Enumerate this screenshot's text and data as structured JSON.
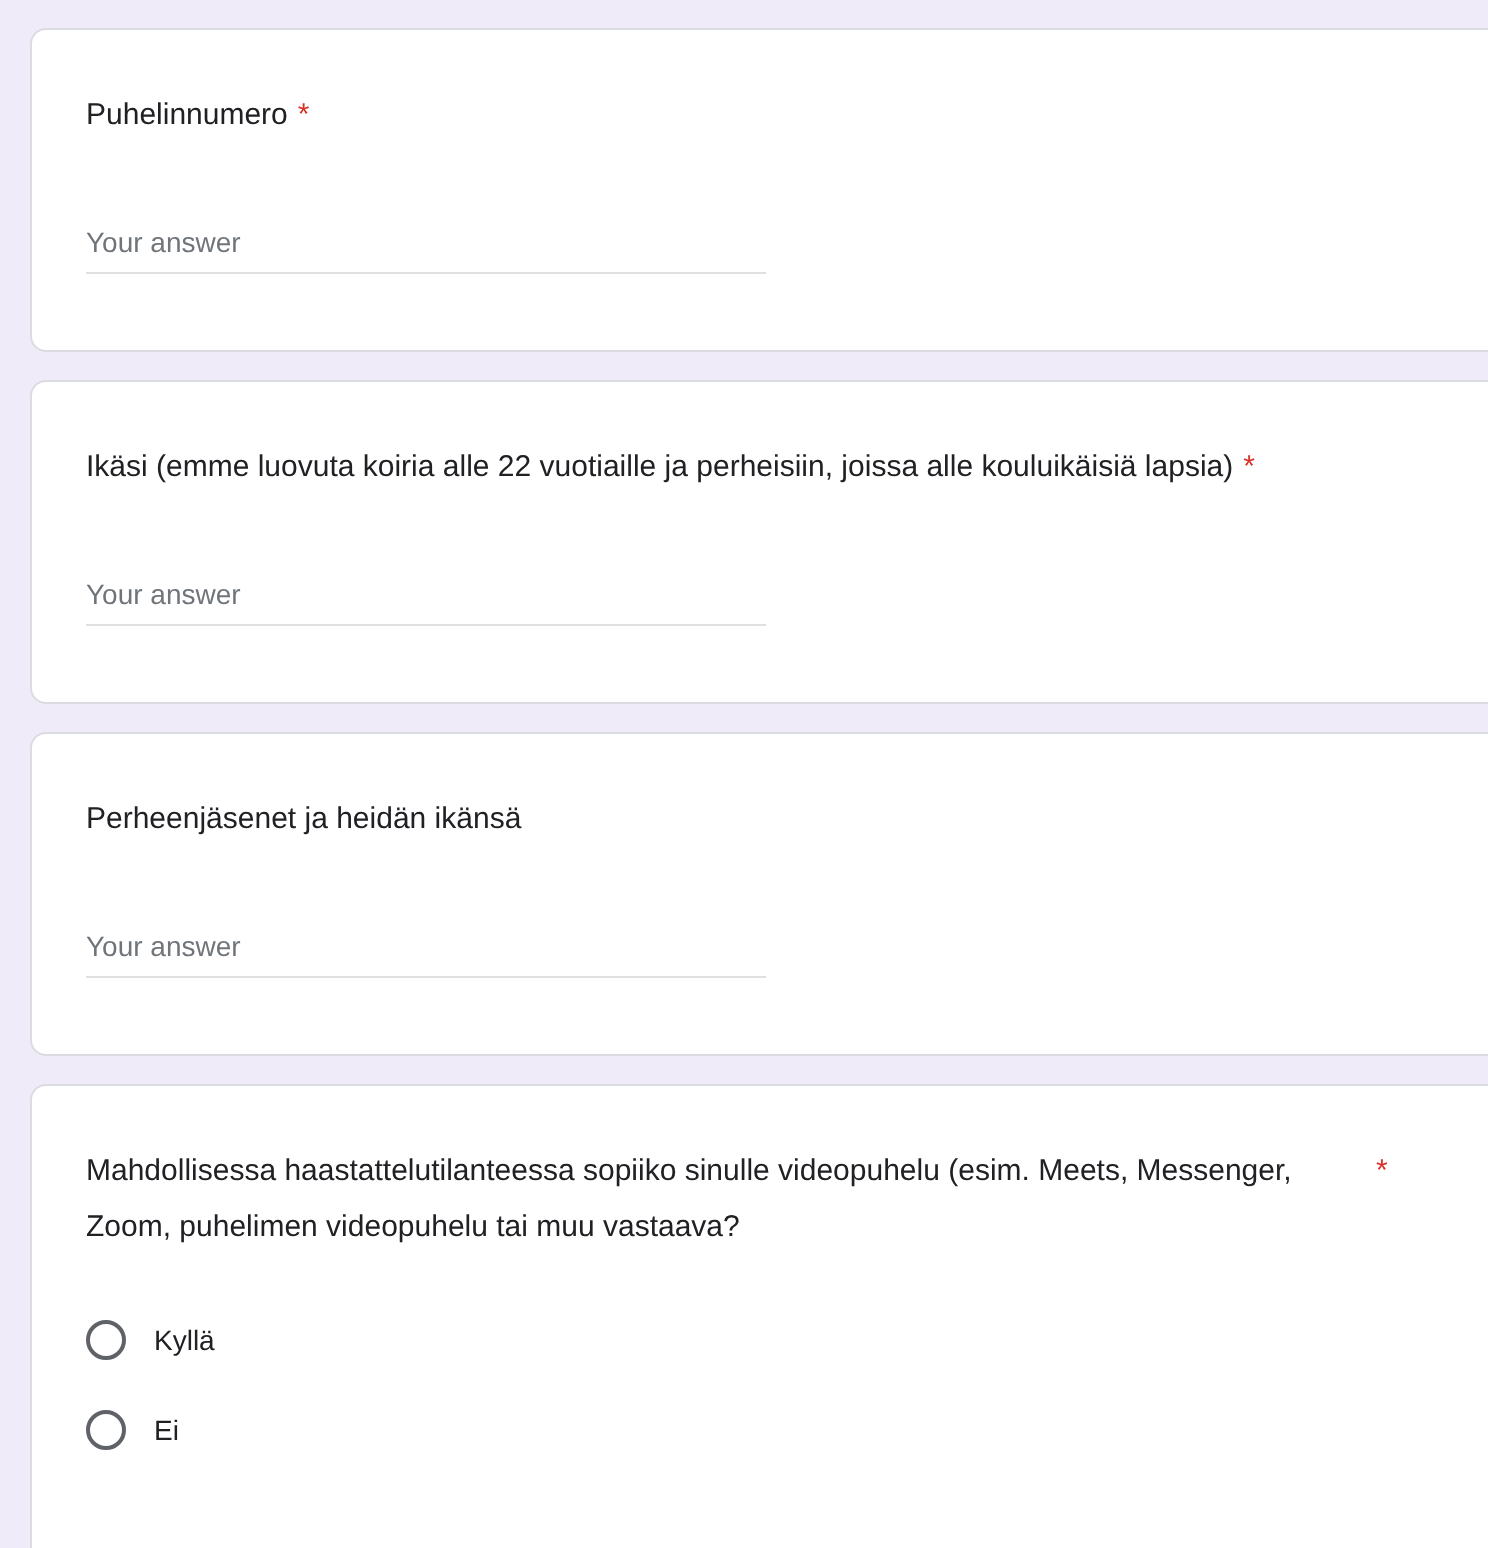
{
  "questions": [
    {
      "kind": "text",
      "title": "Puhelinnumero",
      "required_mark": "*",
      "placeholder": "Your answer"
    },
    {
      "kind": "text",
      "title": "Ikäsi (emme luovuta koiria alle 22 vuotiaille ja perheisiin, joissa alle kouluikäisiä lapsia)",
      "required_mark": "*",
      "placeholder": "Your answer"
    },
    {
      "kind": "text",
      "title": "Perheenjäsenet ja heidän ikänsä",
      "placeholder": "Your answer"
    },
    {
      "kind": "radio",
      "title": "Mahdollisessa haastattelutilanteessa sopiiko sinulle videopuhelu (esim. Meets, Messenger, Zoom, puhelimen videopuhelu tai muu vastaava?",
      "required_mark": "*",
      "options": [
        {
          "label": "Kyllä",
          "selected": false
        },
        {
          "label": "Ei",
          "selected": false
        }
      ]
    }
  ]
}
